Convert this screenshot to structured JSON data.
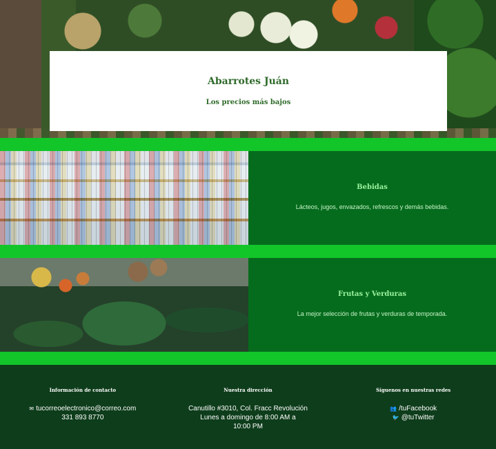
{
  "hero": {
    "title": "Abarrotes Juán",
    "subtitle": "Los precios más bajos"
  },
  "sections": [
    {
      "title": "Bebidas",
      "description": "Lácteos, jugos, envazados, refrescos y demás bebidas."
    },
    {
      "title": "Frutas y Verduras",
      "description": "La mejor selección de frutas y verduras de temporada."
    }
  ],
  "footer": {
    "contact": {
      "heading": "Información de contacto",
      "email": "tucorreoelectronico@correo.com",
      "phone": "331 893 8770"
    },
    "address": {
      "heading": "Nuestra dirección",
      "street": "Canutillo #3010, Col. Fracc Revolución",
      "hours": "Lunes a domingo de 8:00 AM a 10:00 PM"
    },
    "social": {
      "heading": "Síguenos en nuestras redes",
      "facebook": "/tuFacebook",
      "twitter": "@tuTwitter"
    }
  },
  "icons": {
    "email": "envelope-icon",
    "facebook": "people-icon",
    "twitter": "bird-icon"
  },
  "colors": {
    "accent_bar": "#12c62a",
    "section_bg": "#066c1d",
    "footer_bg": "#0e3d1b",
    "title_text": "#2f6a2a"
  }
}
